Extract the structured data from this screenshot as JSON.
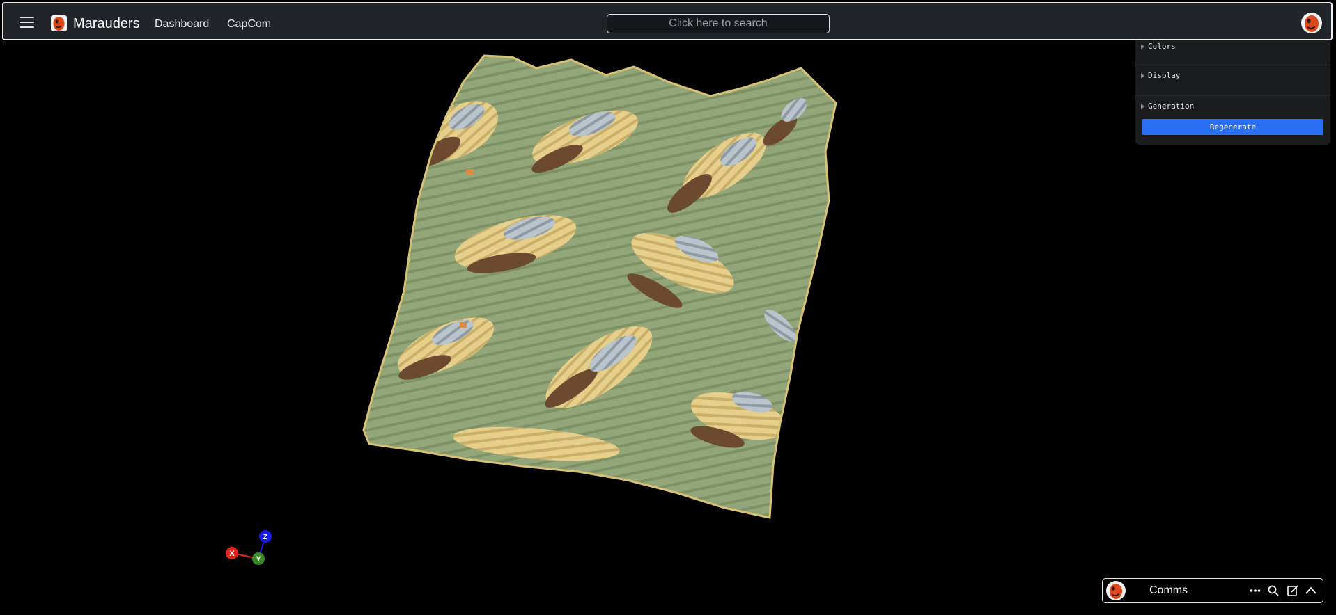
{
  "app": {
    "brand": "Marauders",
    "nav": {
      "dashboard": "Dashboard",
      "capcom": "CapCom"
    },
    "search": {
      "placeholder": "Click here to search"
    }
  },
  "panel": {
    "folders": {
      "colors": "Colors",
      "display": "Display",
      "generation": "Generation"
    },
    "regenerate_label": "Regenerate"
  },
  "comms": {
    "title": "Comms"
  },
  "gizmo": {
    "x": "X",
    "y": "Y",
    "z": "Z"
  },
  "colors": {
    "navbar_bg": "#212529",
    "accent": "#2a6ef3",
    "axis_x": "#e0241f",
    "axis_y": "#3a8a2a",
    "axis_z": "#1a1ae6",
    "terrain_grass": "#93a679",
    "terrain_sand": "#e5cf8a",
    "terrain_soil": "#6b4a30",
    "terrain_rock": "#b9c4cc"
  },
  "icons": {
    "menu": "hamburger-icon",
    "logo": "marauder-mask-icon",
    "comms_more": "more-icon",
    "comms_search": "search-icon",
    "comms_compose": "compose-icon",
    "comms_collapse": "chevron-up-icon"
  }
}
